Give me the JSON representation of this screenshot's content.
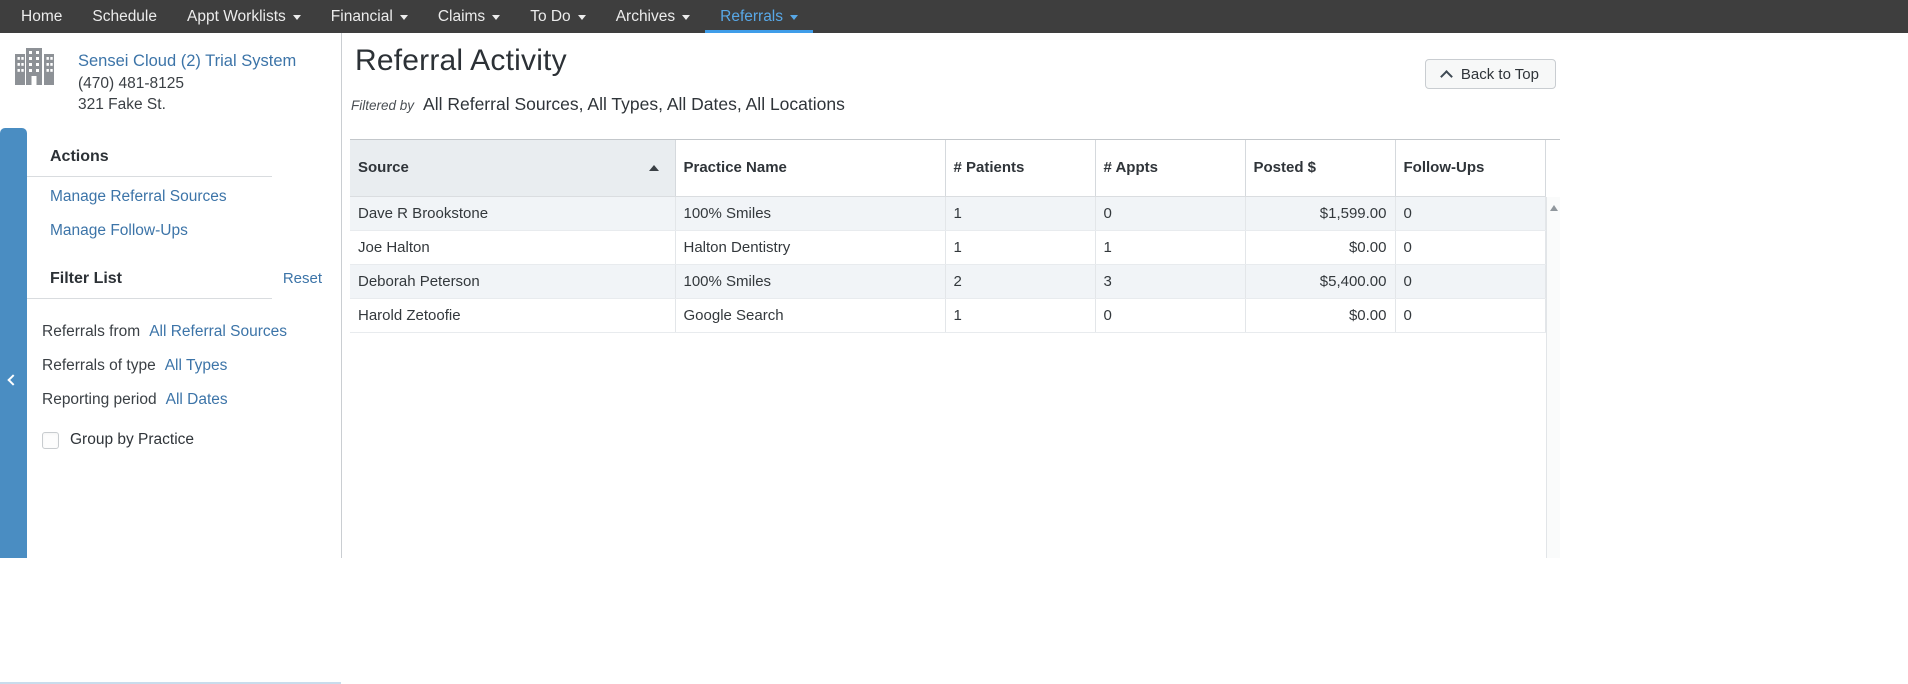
{
  "nav": {
    "items": [
      {
        "label": "Home",
        "has_dropdown": false,
        "active": false
      },
      {
        "label": "Schedule",
        "has_dropdown": false,
        "active": false
      },
      {
        "label": "Appt Worklists",
        "has_dropdown": true,
        "active": false
      },
      {
        "label": "Financial",
        "has_dropdown": true,
        "active": false
      },
      {
        "label": "Claims",
        "has_dropdown": true,
        "active": false
      },
      {
        "label": "To Do",
        "has_dropdown": true,
        "active": false
      },
      {
        "label": "Archives",
        "has_dropdown": true,
        "active": false
      },
      {
        "label": "Referrals",
        "has_dropdown": true,
        "active": true
      }
    ]
  },
  "practice": {
    "name": "Sensei Cloud (2) Trial System",
    "phone": "(470) 481-8125",
    "address": "321 Fake St."
  },
  "page": {
    "title": "Referral Activity",
    "filtered_by_label": "Filtered by",
    "filters_summary": "All Referral Sources, All Types, All Dates, All Locations",
    "back_to_top_label": "Back to Top"
  },
  "sidebar": {
    "actions_title": "Actions",
    "action_links": [
      "Manage Referral Sources",
      "Manage Follow-Ups"
    ],
    "filter_title": "Filter List",
    "reset_label": "Reset",
    "filters": [
      {
        "label": "Referrals from",
        "value": "All Referral Sources"
      },
      {
        "label": "Referrals of type",
        "value": "All Types"
      },
      {
        "label": "Reporting period",
        "value": "All Dates"
      }
    ],
    "group_by_practice_label": "Group by Practice",
    "group_by_practice_checked": false
  },
  "table": {
    "columns": [
      {
        "label": "Source",
        "sort": "asc",
        "align": "left"
      },
      {
        "label": "Practice Name",
        "sort": null,
        "align": "left"
      },
      {
        "label": "# Patients",
        "sort": null,
        "align": "left"
      },
      {
        "label": "# Appts",
        "sort": null,
        "align": "left"
      },
      {
        "label": "Posted $",
        "sort": null,
        "align": "right"
      },
      {
        "label": "Follow-Ups",
        "sort": null,
        "align": "left"
      }
    ],
    "rows": [
      [
        "Dave R Brookstone",
        "100% Smiles",
        "1",
        "0",
        "$1,599.00",
        "0"
      ],
      [
        "Joe Halton",
        "Halton Dentistry",
        "1",
        "1",
        "$0.00",
        "0"
      ],
      [
        "Deborah Peterson",
        "100% Smiles",
        "2",
        "3",
        "$5,400.00",
        "0"
      ],
      [
        "Harold Zetoofie",
        "Google Search",
        "1",
        "0",
        "$0.00",
        "0"
      ]
    ]
  },
  "colors": {
    "nav_bg": "#3e3e3e",
    "nav_active": "#58a8e7",
    "nav_active_underline": "#3f9de9",
    "link_blue": "#3c74a8",
    "sidebar_strip_blue": "#4a8dc2",
    "sorted_header_bg": "#e9edf0",
    "row_stripe": "#f1f4f7"
  }
}
